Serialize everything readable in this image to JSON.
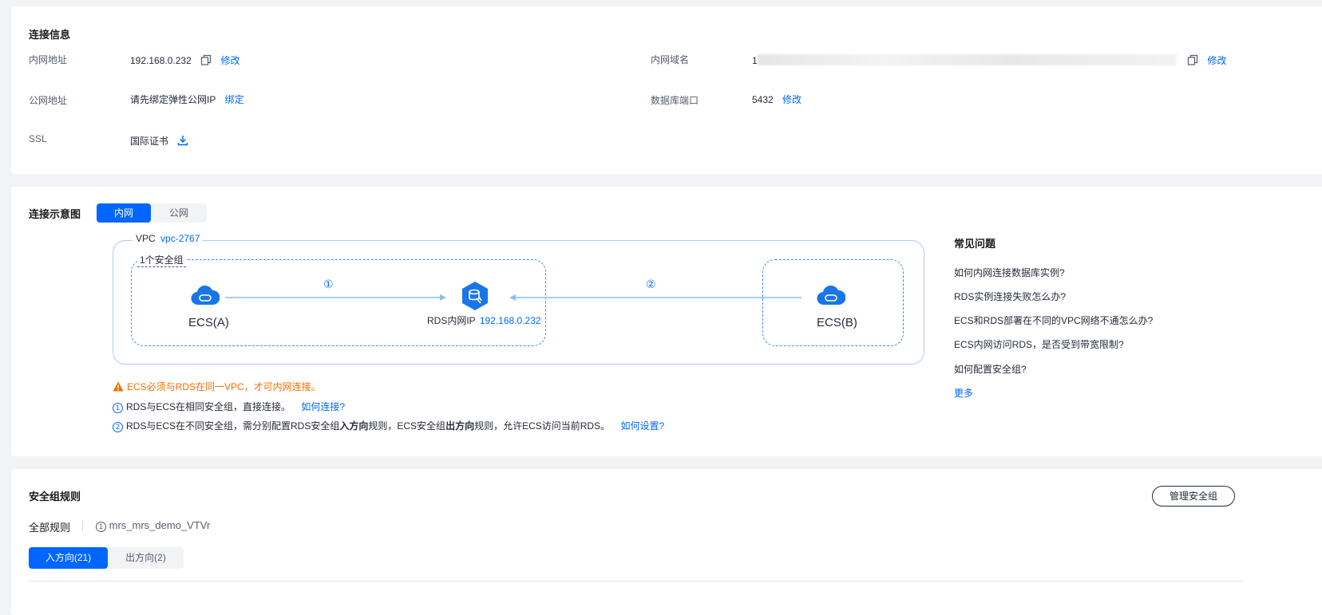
{
  "connection": {
    "title": "连接信息",
    "internal_addr_label": "内网地址",
    "internal_addr_value": "192.168.0.232",
    "internal_addr_edit": "修改",
    "public_addr_label": "公网地址",
    "public_addr_value": "请先绑定弹性公网IP",
    "public_addr_bind": "绑定",
    "ssl_label": "SSL",
    "ssl_value": "国际证书",
    "domain_label": "内网域名",
    "domain_value_prefix": "1",
    "domain_edit": "修改",
    "port_label": "数据库端口",
    "port_value": "5432",
    "port_edit": "修改"
  },
  "diagram": {
    "title": "连接示意图",
    "tabs": [
      {
        "label": "内网",
        "active": true
      },
      {
        "label": "公网",
        "active": false
      }
    ],
    "vpc_label": "VPC",
    "vpc_link": "vpc-2767",
    "secgroup_label": "1个安全组",
    "ecs_a": "ECS(A)",
    "ecs_b": "ECS(B)",
    "rds_label": "RDS内网IP",
    "rds_ip": "192.168.0.232",
    "step1": "①",
    "step2": "②",
    "warning": "ECS必须与RDS在同一VPC，才可内网连接。",
    "note1_text": "RDS与ECS在相同安全组，直接连接。",
    "note1_link": "如何连接?",
    "note2_a": "RDS与ECS在不同安全组，需分别配置RDS安全组",
    "note2_b": "入方向",
    "note2_c": "规则，ECS安全组",
    "note2_d": "出方向",
    "note2_e": "规则，允许ECS访问当前RDS。",
    "note2_link": "如何设置?",
    "warning_color": "#f66f00",
    "accent_color": "#0066ff"
  },
  "faq": {
    "title": "常见问题",
    "items": [
      "如何内网连接数据库实例?",
      "RDS实例连接失败怎么办?",
      "ECS和RDS部署在不同的VPC网络不通怎么办?",
      "ECS内网访问RDS，是否受到带宽限制?",
      "如何配置安全组?"
    ],
    "more": "更多"
  },
  "security": {
    "title": "安全组规则",
    "manage_button": "管理安全组",
    "all_rules": "全部规则",
    "group_name": "mrs_mrs_demo_VTVr",
    "tabs": [
      {
        "label": "入方向(21)",
        "active": true
      },
      {
        "label": "出方向(2)",
        "active": false
      }
    ]
  }
}
